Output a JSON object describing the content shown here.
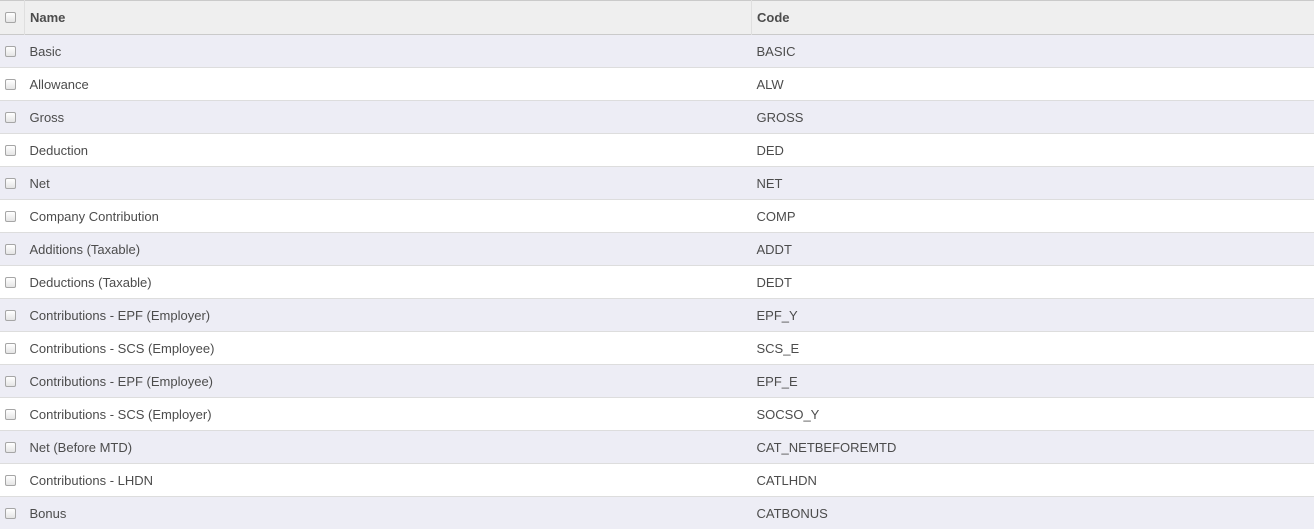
{
  "columns": {
    "name": "Name",
    "code": "Code"
  },
  "rows": [
    {
      "name": "Basic",
      "code": "BASIC"
    },
    {
      "name": "Allowance",
      "code": "ALW"
    },
    {
      "name": "Gross",
      "code": "GROSS"
    },
    {
      "name": "Deduction",
      "code": "DED"
    },
    {
      "name": "Net",
      "code": "NET"
    },
    {
      "name": "Company Contribution",
      "code": "COMP"
    },
    {
      "name": "Additions (Taxable)",
      "code": "ADDT"
    },
    {
      "name": "Deductions (Taxable)",
      "code": "DEDT"
    },
    {
      "name": "Contributions - EPF (Employer)",
      "code": "EPF_Y"
    },
    {
      "name": "Contributions - SCS (Employee)",
      "code": "SCS_E"
    },
    {
      "name": "Contributions - EPF (Employee)",
      "code": "EPF_E"
    },
    {
      "name": "Contributions - SCS (Employer)",
      "code": "SOCSO_Y"
    },
    {
      "name": "Net (Before MTD)",
      "code": "CAT_NETBEFOREMTD"
    },
    {
      "name": "Contributions - LHDN",
      "code": "CATLHDN"
    },
    {
      "name": "Bonus",
      "code": "CATBONUS"
    }
  ]
}
